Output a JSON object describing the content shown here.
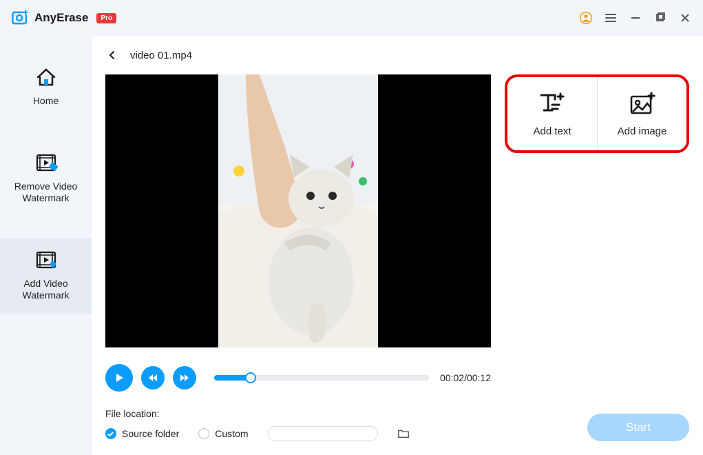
{
  "app": {
    "name": "AnyErase",
    "badge": "Pro"
  },
  "sidebar": {
    "items": [
      {
        "label": "Home"
      },
      {
        "label": "Remove Video Watermark"
      },
      {
        "label": "Add Video Watermark"
      }
    ]
  },
  "crumb": {
    "file": "video 01.mp4"
  },
  "player": {
    "time": "00:02/00:12",
    "progress_percent": 17
  },
  "options": {
    "add_text": "Add text",
    "add_image": "Add image"
  },
  "footer": {
    "file_location_label": "File location:",
    "source_folder": "Source folder",
    "custom": "Custom",
    "start": "Start"
  },
  "colors": {
    "accent": "#0a9cff",
    "highlight": "#e80000"
  }
}
